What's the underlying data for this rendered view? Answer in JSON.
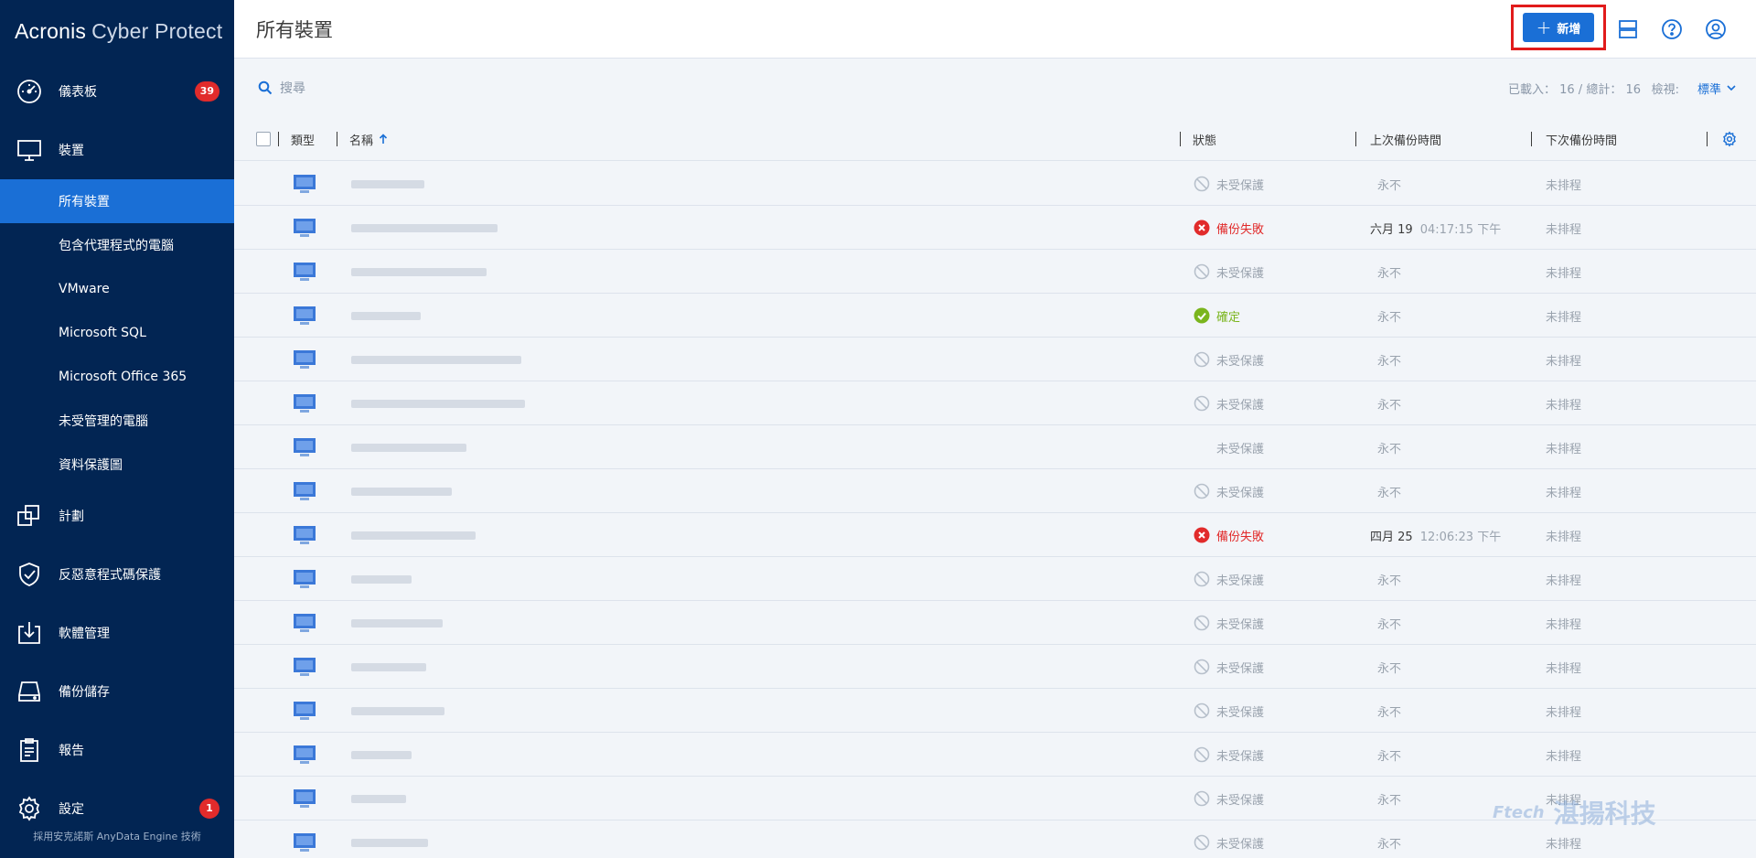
{
  "app": {
    "brand_bold": "Acronis",
    "brand_light": "Cyber Protect",
    "powered_by": "採用安克諾斯 AnyData Engine 技術"
  },
  "sidebar": {
    "items": [
      {
        "label": "儀表板",
        "icon": "dashboard-icon",
        "badge": "39"
      },
      {
        "label": "裝置",
        "icon": "monitor-icon"
      },
      {
        "label": "計劃",
        "icon": "plans-icon"
      },
      {
        "label": "反惡意程式碼保護",
        "icon": "shield-icon"
      },
      {
        "label": "軟體管理",
        "icon": "software-icon"
      },
      {
        "label": "備份儲存",
        "icon": "storage-icon"
      },
      {
        "label": "報告",
        "icon": "report-icon"
      },
      {
        "label": "設定",
        "icon": "gear-icon",
        "badge": "1"
      }
    ],
    "sub_items": [
      {
        "label": "所有裝置",
        "active": true
      },
      {
        "label": "包含代理程式的電腦"
      },
      {
        "label": "VMware"
      },
      {
        "label": "Microsoft SQL"
      },
      {
        "label": "Microsoft Office 365"
      },
      {
        "label": "未受管理的電腦"
      },
      {
        "label": "資料保護圖"
      }
    ]
  },
  "header": {
    "title": "所有裝置",
    "add_label": "新增"
  },
  "toolbar": {
    "search_placeholder": "搜尋",
    "counts": "已載入： 16 / 總計： 16",
    "view_label": "檢視:",
    "view_value": "標準"
  },
  "table": {
    "columns": {
      "type": "類型",
      "name": "名稱",
      "status": "狀態",
      "last_backup": "上次備份時間",
      "next_backup": "下次備份時間"
    },
    "rows": [
      {
        "status": "未受保護",
        "status_kind": "unprotected",
        "last_date": "",
        "last_time": "永不",
        "next": "未排程"
      },
      {
        "status": "備份失敗",
        "status_kind": "failed",
        "last_date": "六月 19",
        "last_time": "04:17:15 下午",
        "next": "未排程"
      },
      {
        "status": "未受保護",
        "status_kind": "unprotected",
        "last_date": "",
        "last_time": "永不",
        "next": "未排程"
      },
      {
        "status": "確定",
        "status_kind": "ok",
        "last_date": "",
        "last_time": "永不",
        "next": "未排程"
      },
      {
        "status": "未受保護",
        "status_kind": "unprotected",
        "last_date": "",
        "last_time": "永不",
        "next": "未排程"
      },
      {
        "status": "未受保護",
        "status_kind": "unprotected",
        "last_date": "",
        "last_time": "永不",
        "next": "未排程"
      },
      {
        "status": "未受保護",
        "status_kind": "none",
        "last_date": "",
        "last_time": "永不",
        "next": "未排程"
      },
      {
        "status": "未受保護",
        "status_kind": "unprotected",
        "last_date": "",
        "last_time": "永不",
        "next": "未排程"
      },
      {
        "status": "備份失敗",
        "status_kind": "failed",
        "last_date": "四月 25",
        "last_time": "12:06:23 下午",
        "next": "未排程"
      },
      {
        "status": "未受保護",
        "status_kind": "unprotected",
        "last_date": "",
        "last_time": "永不",
        "next": "未排程"
      },
      {
        "status": "未受保護",
        "status_kind": "unprotected",
        "last_date": "",
        "last_time": "永不",
        "next": "未排程"
      },
      {
        "status": "未受保護",
        "status_kind": "unprotected",
        "last_date": "",
        "last_time": "永不",
        "next": "未排程"
      },
      {
        "status": "未受保護",
        "status_kind": "unprotected",
        "last_date": "",
        "last_time": "永不",
        "next": "未排程"
      },
      {
        "status": "未受保護",
        "status_kind": "unprotected",
        "last_date": "",
        "last_time": "永不",
        "next": "未排程"
      },
      {
        "status": "未受保護",
        "status_kind": "unprotected",
        "last_date": "",
        "last_time": "永不",
        "next": "未排程"
      },
      {
        "status": "未受保護",
        "status_kind": "unprotected",
        "last_date": "",
        "last_time": "永不",
        "next": "未排程"
      }
    ]
  },
  "watermark": {
    "brand": "Ftech",
    "text": "湛揚科技"
  },
  "colors": {
    "sidebar_bg": "#022553",
    "accent": "#1a6fd6",
    "failed": "#e12b2b",
    "ok": "#7ab51d",
    "highlight": "#e11b1b"
  }
}
